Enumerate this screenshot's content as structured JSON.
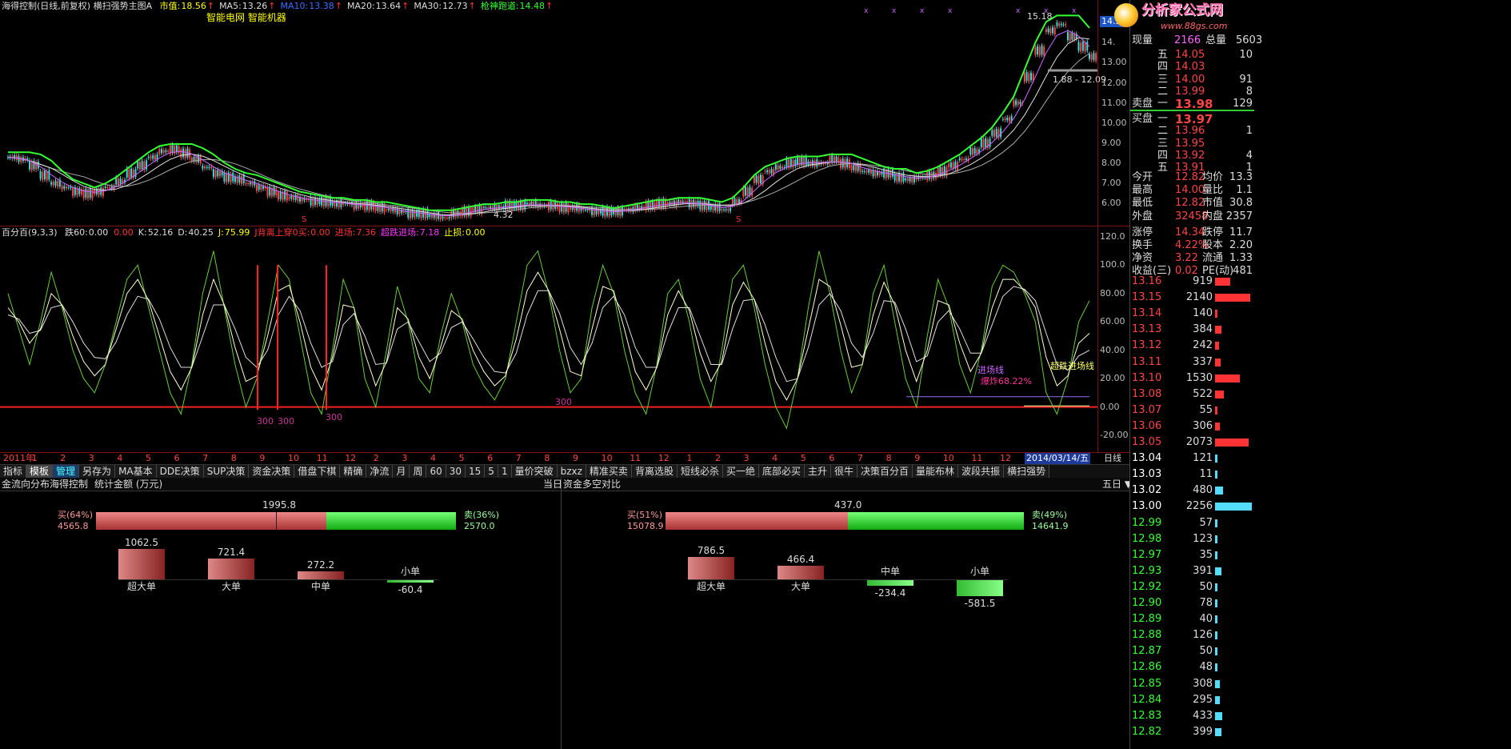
{
  "main_chart": {
    "title": "海得控制(日线,前复权)",
    "indicator_name": "横扫强势主图A",
    "items": [
      {
        "label": "市值:",
        "value": "18.56",
        "color": "#ffff00"
      },
      {
        "label": "MA5:",
        "value": "13.26",
        "color": "#dddddd"
      },
      {
        "label": "MA10:",
        "value": "13.38",
        "color": "#3b6fff"
      },
      {
        "label": "MA20:",
        "value": "13.64",
        "color": "#dddddd"
      },
      {
        "label": "MA30:",
        "value": "12.73",
        "color": "#dddddd"
      },
      {
        "label": "枪神跑道:",
        "value": "14.48",
        "color": "#33ff33"
      }
    ],
    "concepts": "智能电网 智能机器",
    "high_label": "15.18",
    "low_label": "4.32",
    "range_label": "1.88 - 12.09",
    "current_price_tag": "14.33",
    "marker_s": "S",
    "y_labels": [
      "14.",
      "13.00",
      "12.00",
      "11.00",
      "10.00",
      "9.00",
      "8.00",
      "7.00",
      "6.00"
    ],
    "price_series": [
      8.3,
      8.2,
      7.9,
      7.4,
      7.0,
      6.8,
      6.6,
      6.5,
      6.6,
      6.8,
      7.1,
      7.5,
      7.9,
      8.3,
      8.6,
      8.7,
      8.5,
      8.2,
      7.8,
      7.5,
      7.3,
      7.2,
      7.0,
      6.8,
      6.6,
      6.4,
      6.3,
      6.2,
      6.1,
      6.1,
      6.0,
      6.0,
      5.9,
      5.9,
      5.8,
      5.7,
      5.6,
      5.5,
      5.5,
      5.4,
      5.3,
      5.5,
      5.6,
      5.7,
      5.8,
      5.8,
      5.9,
      5.9,
      6.0,
      5.9,
      5.9,
      5.8,
      5.8,
      5.7,
      5.6,
      5.6,
      5.6,
      5.7,
      5.8,
      5.9,
      6.0,
      6.0,
      6.1,
      6.0,
      5.9,
      5.8,
      5.7,
      6.1,
      6.6,
      7.2,
      7.6,
      7.8,
      8.0,
      8.1,
      8.0,
      8.0,
      8.2,
      8.0,
      7.8,
      7.6,
      7.5,
      7.5,
      7.3,
      7.2,
      7.3,
      7.4,
      7.6,
      7.9,
      8.2,
      8.6,
      9.0,
      9.5,
      10.2,
      11.0,
      12.3,
      13.6,
      14.6,
      14.9,
      14.3,
      13.8,
      13.3
    ]
  },
  "sub_chart": {
    "title": "百分百(9,3,3)",
    "items": [
      {
        "label": "跌60:",
        "value": "0.00",
        "color": "#dddddd"
      },
      {
        "label": "",
        "value": "0.00",
        "color": "#ff3333"
      },
      {
        "label": "K:",
        "value": "52.16",
        "color": "#dddddd"
      },
      {
        "label": "D:",
        "value": "40.25",
        "color": "#dddddd"
      },
      {
        "label": "J:",
        "value": "75.99",
        "color": "#ffff00"
      },
      {
        "label": "J背离上穿0买:",
        "value": "0.00",
        "color": "#ff3333"
      },
      {
        "label": "进场:",
        "value": "7.36",
        "color": "#ff3333"
      },
      {
        "label": "超跌进场:",
        "value": "7.18",
        "color": "#ff33ff"
      },
      {
        "label": "止损:",
        "value": "0.00",
        "color": "#ffff00"
      }
    ],
    "y_labels": [
      "120.0",
      "100.0",
      "80.00",
      "60.00",
      "40.00",
      "20.00",
      "0.00",
      "-20.00"
    ],
    "markers_300": [
      "300",
      "300",
      "300",
      "300"
    ],
    "entry_line_label": "进场线",
    "oversold_line_label": "超跌进场线",
    "explode_label": "爆炸68.22%",
    "j_series": [
      80,
      55,
      30,
      60,
      95,
      70,
      40,
      20,
      10,
      30,
      60,
      90,
      100,
      70,
      40,
      10,
      -5,
      30,
      80,
      110,
      70,
      30,
      0,
      20,
      60,
      100,
      90,
      50,
      10,
      -5,
      40,
      90,
      70,
      20,
      0,
      40,
      85,
      60,
      20,
      10,
      50,
      80,
      60,
      30,
      15,
      5,
      20,
      60,
      100,
      110,
      80,
      40,
      10,
      20,
      70,
      100,
      80,
      40,
      10,
      -5,
      30,
      80,
      90,
      60,
      20,
      0,
      40,
      90,
      100,
      70,
      30,
      0,
      -15,
      20,
      70,
      110,
      80,
      40,
      10,
      30,
      80,
      100,
      60,
      20,
      0,
      50,
      90,
      70,
      30,
      10,
      40,
      85,
      100,
      95,
      80,
      60,
      10,
      -5,
      20,
      60,
      75
    ],
    "k_series": [
      70,
      60,
      45,
      55,
      80,
      72,
      50,
      32,
      22,
      30,
      55,
      80,
      90,
      75,
      50,
      25,
      12,
      28,
      65,
      90,
      72,
      42,
      18,
      22,
      50,
      82,
      86,
      60,
      28,
      12,
      35,
      72,
      70,
      38,
      15,
      32,
      70,
      62,
      35,
      20,
      42,
      68,
      62,
      40,
      25,
      15,
      22,
      48,
      82,
      95,
      82,
      55,
      25,
      22,
      55,
      85,
      82,
      55,
      25,
      12,
      28,
      65,
      82,
      68,
      38,
      18,
      32,
      72,
      88,
      76,
      45,
      18,
      5,
      20,
      55,
      90,
      85,
      58,
      28,
      30,
      65,
      88,
      72,
      40,
      18,
      40,
      75,
      72,
      45,
      25,
      38,
      70,
      90,
      90,
      82,
      70,
      35,
      15,
      22,
      45,
      52
    ],
    "d_series": [
      65,
      62,
      52,
      54,
      70,
      72,
      60,
      45,
      35,
      34,
      46,
      65,
      78,
      76,
      62,
      42,
      28,
      28,
      50,
      72,
      72,
      55,
      35,
      28,
      40,
      65,
      78,
      68,
      45,
      28,
      32,
      58,
      66,
      50,
      30,
      31,
      55,
      60,
      46,
      32,
      38,
      56,
      60,
      48,
      35,
      25,
      24,
      38,
      65,
      82,
      82,
      66,
      42,
      30,
      45,
      70,
      78,
      65,
      42,
      28,
      28,
      52,
      70,
      70,
      50,
      30,
      30,
      55,
      75,
      76,
      58,
      35,
      18,
      20,
      42,
      72,
      80,
      68,
      45,
      35,
      52,
      75,
      74,
      55,
      32,
      36,
      60,
      68,
      55,
      38,
      38,
      58,
      78,
      85,
      83,
      75,
      52,
      30,
      26,
      36,
      40
    ]
  },
  "timeline": {
    "labels": [
      "2011年",
      "1",
      "2",
      "3",
      "4",
      "5",
      "6",
      "7",
      "8",
      "9",
      "10",
      "11",
      "12",
      "2",
      "3",
      "4",
      "5",
      "6",
      "7",
      "8",
      "9",
      "10",
      "11",
      "12",
      "1",
      "2",
      "3",
      "4",
      "5",
      "6",
      "7",
      "8",
      "9",
      "10",
      "11",
      "12",
      "1"
    ],
    "current_date": "2014/03/14/五",
    "period": "日线"
  },
  "toolbar": {
    "buttons": [
      "指标",
      "模板",
      "管理",
      "另存为",
      "MA基本",
      "DDE决策",
      "SUP决策",
      "资金决策",
      "借盘下棋",
      "精确",
      "净流",
      "月",
      "周",
      "60",
      "30",
      "15",
      "5",
      "1",
      "量价突破",
      "bzxz",
      "精准买卖",
      "背离选股",
      "短线必杀",
      "买一绝",
      "底部必买",
      "主升",
      "很牛",
      "决策百分百",
      "量能布林",
      "波段共振",
      "横扫强势"
    ]
  },
  "left_panel": {
    "title": "金流向分布",
    "tab1": "海得控制",
    "tab2": "统计金额 (万元)",
    "period": "当日",
    "buy_label": "买(64%)",
    "buy_value": "4565.8",
    "sell_label": "卖(36%)",
    "sell_value": "2570.0",
    "net_value": "1995.8",
    "buy_fraction": 0.64,
    "bars": [
      {
        "label": "超大单",
        "value": "1062.5",
        "num": 1062.5
      },
      {
        "label": "大单",
        "value": "721.4",
        "num": 721.4
      },
      {
        "label": "中单",
        "value": "272.2",
        "num": 272.2
      },
      {
        "label": "小单",
        "value": "-60.4",
        "num": -60.4
      }
    ]
  },
  "right_panel": {
    "title": "资金多空对比",
    "period": "五日 ▼",
    "buy_label": "买(51%)",
    "buy_value": "15078.9",
    "sell_label": "卖(49%)",
    "sell_value": "14641.9",
    "net_value": "437.0",
    "buy_fraction": 0.51,
    "bars": [
      {
        "label": "超大单",
        "value": "786.5",
        "num": 786.5
      },
      {
        "label": "大单",
        "value": "466.4",
        "num": 466.4
      },
      {
        "label": "中单",
        "value": "-234.4",
        "num": -234.4
      },
      {
        "label": "小单",
        "value": "-581.5",
        "num": -581.5
      }
    ]
  },
  "order_book": {
    "header": {
      "l1": "现量",
      "v1": "2166",
      "l2": "总量",
      "v2": "5603"
    },
    "sell_label": "卖盘",
    "buy_label": "买盘",
    "asks": [
      {
        "name": "五",
        "price": "14.05",
        "vol": "10"
      },
      {
        "name": "四",
        "price": "14.03",
        "vol": ""
      },
      {
        "name": "三",
        "price": "14.00",
        "vol": "91"
      },
      {
        "name": "二",
        "price": "13.99",
        "vol": "8"
      },
      {
        "name": "一",
        "price": "13.98",
        "vol": "129"
      }
    ],
    "bids": [
      {
        "name": "一",
        "price": "13.97",
        "vol": ""
      },
      {
        "name": "二",
        "price": "13.96",
        "vol": "1"
      },
      {
        "name": "三",
        "price": "13.95",
        "vol": ""
      },
      {
        "name": "四",
        "price": "13.92",
        "vol": "4"
      },
      {
        "name": "五",
        "price": "13.91",
        "vol": "1"
      }
    ]
  },
  "quote_info": [
    {
      "l1": "今开",
      "v1": "12.82",
      "l2": "均价",
      "v2": "13.3"
    },
    {
      "l1": "最高",
      "v1": "14.00",
      "l2": "量比",
      "v2": "1.1"
    },
    {
      "l1": "最低",
      "v1": "12.82",
      "l2": "市值",
      "v2": "30.8"
    },
    {
      "l1": "外盘",
      "v1": "32458",
      "l2": "内盘",
      "v2": "2357"
    },
    {
      "l1": "涨停",
      "v1": "14.34",
      "l2": "跌停",
      "v2": "11.7"
    },
    {
      "l1": "换手",
      "v1": "4.22%",
      "l2": "股本",
      "v2": "2.20"
    },
    {
      "l1": "净资",
      "v1": "3.22",
      "l2": "流通",
      "v2": "1.33"
    },
    {
      "l1": "收益(三)",
      "v1": "0.02",
      "l2": "PE(动)",
      "v2": "481"
    }
  ],
  "price_ladder": [
    {
      "price": "13.16",
      "vol": "919",
      "num": 919
    },
    {
      "price": "13.15",
      "vol": "2140",
      "num": 2140
    },
    {
      "price": "13.14",
      "vol": "140",
      "num": 140
    },
    {
      "price": "13.13",
      "vol": "384",
      "num": 384
    },
    {
      "price": "13.12",
      "vol": "242",
      "num": 242
    },
    {
      "price": "13.11",
      "vol": "337",
      "num": 337
    },
    {
      "price": "13.10",
      "vol": "1530",
      "num": 1530
    },
    {
      "price": "13.08",
      "vol": "522",
      "num": 522
    },
    {
      "price": "13.07",
      "vol": "55",
      "num": 55
    },
    {
      "price": "13.06",
      "vol": "306",
      "num": 306
    },
    {
      "price": "13.05",
      "vol": "2073",
      "num": 2073
    },
    {
      "price": "13.04",
      "vol": "121",
      "num": 121
    },
    {
      "price": "13.03",
      "vol": "11",
      "num": 11
    },
    {
      "price": "13.02",
      "vol": "480",
      "num": 480
    },
    {
      "price": "13.00",
      "vol": "2256",
      "num": 2256
    },
    {
      "price": "12.99",
      "vol": "57",
      "num": 57
    },
    {
      "price": "12.98",
      "vol": "123",
      "num": 123
    },
    {
      "price": "12.97",
      "vol": "35",
      "num": 35
    },
    {
      "price": "12.93",
      "vol": "391",
      "num": 391
    },
    {
      "price": "12.92",
      "vol": "50",
      "num": 50
    },
    {
      "price": "12.90",
      "vol": "78",
      "num": 78
    },
    {
      "price": "12.89",
      "vol": "40",
      "num": 40
    },
    {
      "price": "12.88",
      "vol": "126",
      "num": 126
    },
    {
      "price": "12.87",
      "vol": "50",
      "num": 50
    },
    {
      "price": "12.86",
      "vol": "48",
      "num": 48
    },
    {
      "price": "12.85",
      "vol": "308",
      "num": 308
    },
    {
      "price": "12.84",
      "vol": "295",
      "num": 295
    },
    {
      "price": "12.83",
      "vol": "433",
      "num": 433
    },
    {
      "price": "12.82",
      "vol": "399",
      "num": 399
    }
  ],
  "watermark": {
    "text": "分析家公式网",
    "url": "www.88gs.com"
  },
  "colors": {
    "up": "#ff3333",
    "down": "#33ff33",
    "cyan": "#33ccff",
    "yellow": "#ffff00",
    "grid": "#7a1010",
    "ma_green": "#33ff33"
  }
}
